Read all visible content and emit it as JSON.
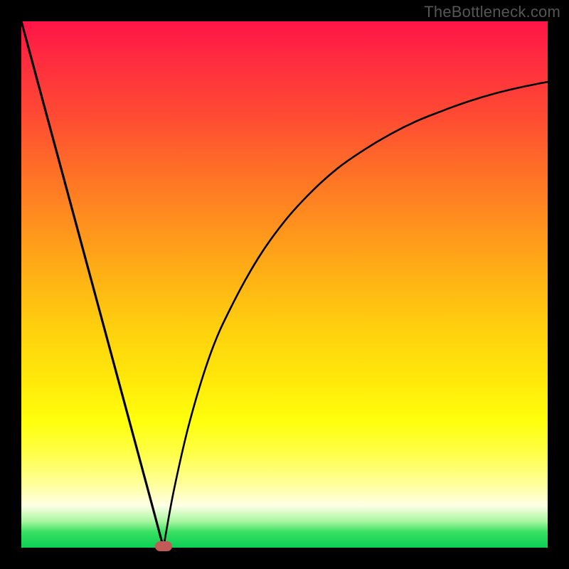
{
  "watermark": "TheBottleneck.com",
  "colors": {
    "frame": "#000000",
    "curve": "#000000",
    "marker": "#c25b57"
  },
  "chart_data": {
    "type": "line",
    "title": "",
    "xlabel": "",
    "ylabel": "",
    "xlim": [
      0,
      100
    ],
    "ylim": [
      0,
      100
    ],
    "grid": false,
    "legend": false,
    "series": [
      {
        "name": "left-branch",
        "x": [
          0,
          5,
          10,
          15,
          20,
          25,
          27
        ],
        "y": [
          100,
          81.5,
          63,
          44.5,
          26,
          7.5,
          0
        ]
      },
      {
        "name": "right-branch",
        "x": [
          27,
          29,
          32,
          36,
          40,
          45,
          50,
          55,
          60,
          65,
          70,
          75,
          80,
          85,
          90,
          95,
          100
        ],
        "y": [
          0,
          11,
          24,
          37,
          46,
          55,
          62,
          67.5,
          72,
          75.5,
          78.5,
          81,
          83,
          84.8,
          86.3,
          87.5,
          88.5
        ]
      }
    ],
    "marker": {
      "x": 27,
      "y": 0
    },
    "background_gradient": {
      "direction": "vertical",
      "stops": [
        {
          "pos": 0.0,
          "color": "#ff1547"
        },
        {
          "pos": 0.5,
          "color": "#ffd010"
        },
        {
          "pos": 0.8,
          "color": "#ffff30"
        },
        {
          "pos": 0.92,
          "color": "#ffffe6"
        },
        {
          "pos": 1.0,
          "color": "#0bcf53"
        }
      ]
    }
  }
}
